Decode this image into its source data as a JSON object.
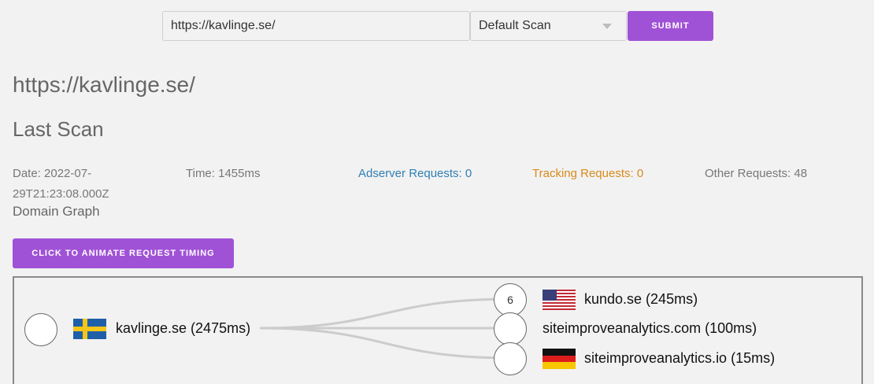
{
  "form": {
    "url_value": "https://kavlinge.se/",
    "scan_type": "Default Scan",
    "submit_label": "SUBMIT"
  },
  "page_title": "https://kavlinge.se/",
  "section_title": "Last Scan",
  "stats": {
    "date": "Date: 2022-07-29T21:23:08.000Z",
    "time": "Time: 1455ms",
    "adserver": "Adserver Requests: 0",
    "tracking": "Tracking Requests: 0",
    "other": "Other Requests: 48"
  },
  "graph_label": "Domain Graph",
  "animate_label": "CLICK TO ANIMATE REQUEST TIMING",
  "graph": {
    "root": {
      "label": "kavlinge.se (2475ms)",
      "flag": "sweden-flag"
    },
    "children": [
      {
        "label": "kundo.se (245ms)",
        "count": "6",
        "flag": "usa-flag"
      },
      {
        "label": "siteimproveanalytics.com (100ms)",
        "count": "",
        "flag": ""
      },
      {
        "label": "siteimproveanalytics.io (15ms)",
        "count": "",
        "flag": "germany-flag"
      }
    ]
  },
  "colors": {
    "accent": "#a052d6",
    "adserver": "#2f7fb5",
    "tracking": "#d88a1c",
    "link": "#cccccc"
  }
}
